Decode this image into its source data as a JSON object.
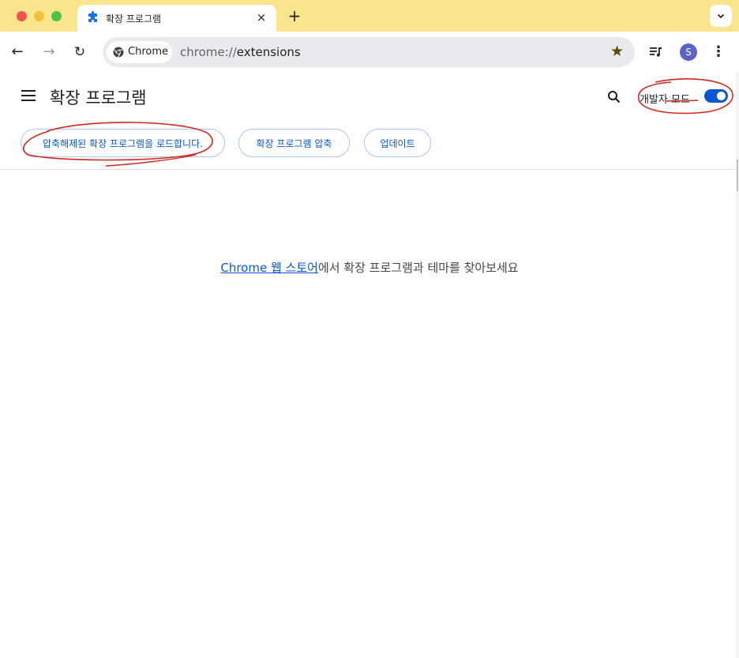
{
  "browser": {
    "tab": {
      "title": "확장 프로그램",
      "close_glyph": "×",
      "icon": "puzzle-icon"
    },
    "new_tab_glyph": "+",
    "tab_search_glyph": "⌄",
    "nav": {
      "back_glyph": "←",
      "forward_glyph": "→",
      "reload_glyph": "↻"
    },
    "address_bar": {
      "chip_label": "Chrome",
      "url_prefix": "chrome://",
      "url_path": "extensions",
      "bookmark_glyph": "★"
    },
    "profile_initial": "S",
    "menu_glyph": "⋮",
    "colors": {
      "titlebar": "#f9e58c",
      "accent": "#0b57d0",
      "annotation": "#d1281f"
    }
  },
  "extensions_page": {
    "title": "확장 프로그램",
    "dev_mode_label": "개발자 모드",
    "dev_mode_enabled": true,
    "buttons": {
      "load_unpacked": "압축해제된 확장 프로그램을 로드합니다.",
      "pack": "확장 프로그램 압축",
      "update": "업데이트"
    },
    "empty_state": {
      "link_text": "Chrome 웹 스토어",
      "rest_text": "에서 확장 프로그램과 테마를 찾아보세요"
    }
  }
}
